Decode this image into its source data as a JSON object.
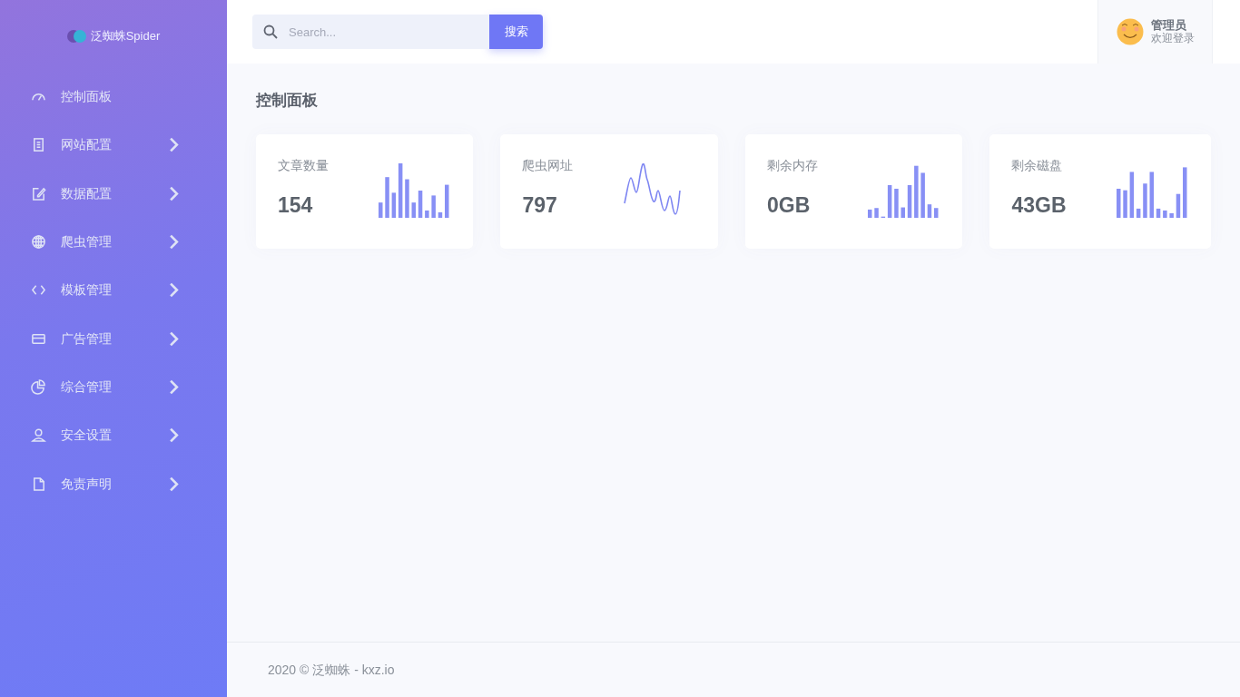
{
  "sidebar": {
    "logo": "泛蜘蛛Spider",
    "items": [
      {
        "label": "控制面板",
        "submenu": false
      },
      {
        "label": "网站配置",
        "submenu": true
      },
      {
        "label": "数据配置",
        "submenu": true
      },
      {
        "label": "爬虫管理",
        "submenu": true
      },
      {
        "label": "模板管理",
        "submenu": true
      },
      {
        "label": "广告管理",
        "submenu": true
      },
      {
        "label": "综合管理",
        "submenu": true
      },
      {
        "label": "安全设置",
        "submenu": true
      },
      {
        "label": "免责声明",
        "submenu": true
      }
    ]
  },
  "header": {
    "search": {
      "placeholder": "Search..."
    },
    "search_button": "搜索",
    "user": {
      "name": "管理员",
      "greeting": "欢迎登录"
    }
  },
  "page_title": "控制面板",
  "cards": [
    {
      "label": "文章数量",
      "value": "154",
      "kind": "bars"
    },
    {
      "label": "爬虫网址",
      "value": "797",
      "kind": "wave"
    },
    {
      "label": "剩余内存",
      "value": "0GB",
      "kind": "bars"
    },
    {
      "label": "剩余磁盘",
      "value": "43GB",
      "kind": "bars"
    }
  ],
  "footer": "2020 © 泛蜘蛛 - kxz.io"
}
